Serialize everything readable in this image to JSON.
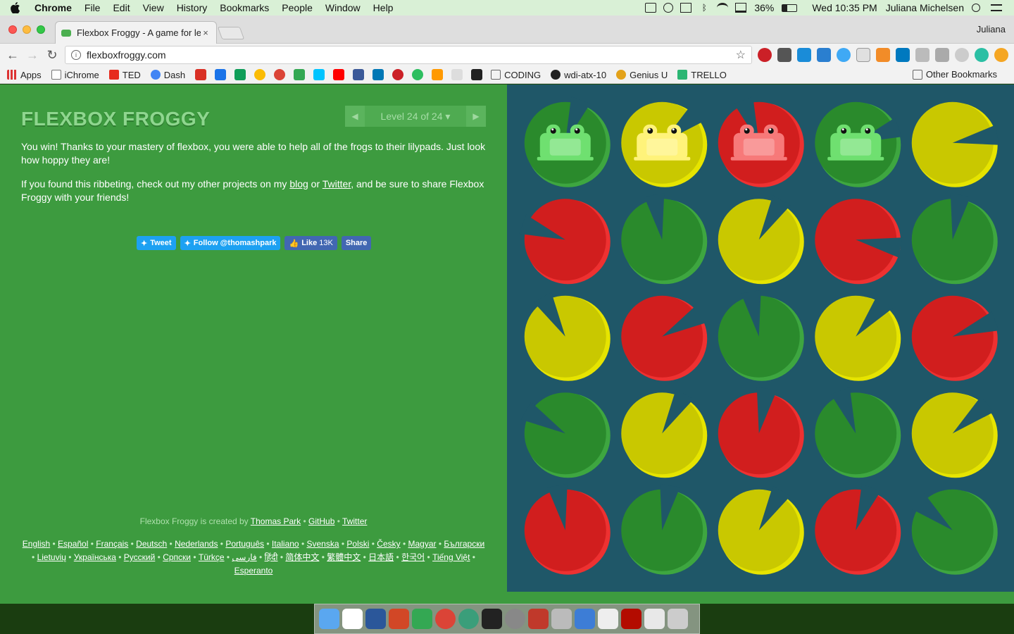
{
  "menubar": {
    "items": [
      "Chrome",
      "File",
      "Edit",
      "View",
      "History",
      "Bookmarks",
      "People",
      "Window",
      "Help"
    ],
    "battery": "36%",
    "clock": "Wed 10:35 PM",
    "user": "Juliana Michelsen"
  },
  "tab": {
    "title": "Flexbox Froggy - A game for le",
    "close": "×"
  },
  "profile": "Juliana",
  "omnibox": {
    "url": "flexboxfroggy.com"
  },
  "bookmarks": {
    "apps": "Apps",
    "ichrome": "iChrome",
    "ted": "TED",
    "dash": "Dash",
    "coding": "CODING",
    "wdi": "wdi-atx-10",
    "genius": "Genius U",
    "trello": "TRELLO",
    "other": "Other Bookmarks"
  },
  "game": {
    "logo": "FLEXBOX FROGGY",
    "level": "Level 24 of 24",
    "win_text": "You win! Thanks to your mastery of flexbox, you were able to help all of the frogs to their lilypads. Just look how hoppy they are!",
    "p2_a": "If you found this ribbeting, check out my other projects on my ",
    "p2_blog": "blog",
    "p2_or": " or ",
    "p2_twitter": "Twitter",
    "p2_b": ", and be sure to share Flexbox Froggy with your friends!",
    "tweet": "Tweet",
    "follow": "Follow @thomashpark",
    "like": "Like",
    "like_count": "13K",
    "share": "Share"
  },
  "credits": {
    "prefix": "Flexbox Froggy is created by ",
    "author": "Thomas Park",
    "github": "GitHub",
    "twitter": "Twitter"
  },
  "languages": [
    "English",
    "Español",
    "Français",
    "Deutsch",
    "Nederlands",
    "Português",
    "Italiano",
    "Svenska",
    "Polski",
    "Česky",
    "Magyar",
    "Български",
    "Lietuvių",
    "Українська",
    "Русский",
    "Српски",
    "Türkçe",
    "فارسی",
    "हिंदी",
    "简体中文",
    "繁體中文",
    "日本語",
    "한국어",
    "Tiếng Việt",
    "Esperanto"
  ],
  "pond": {
    "colors": {
      "green": "#2a8a2c",
      "green_rim": "#3ea640",
      "yellow": "#c9c800",
      "yellow_rim": "#e6e400",
      "red": "#d11e1e",
      "red_rim": "#ee3131",
      "frog_green": "#6fe070",
      "frog_yellow": "#fff37a",
      "frog_red": "#f77979",
      "water": "#1f5768"
    },
    "rows": [
      [
        "green",
        "yellow",
        "red",
        "green",
        "yellow"
      ],
      [
        "red",
        "green",
        "yellow",
        "red",
        "green"
      ],
      [
        "yellow",
        "red",
        "green",
        "yellow",
        "red"
      ],
      [
        "green",
        "yellow",
        "red",
        "green",
        "yellow"
      ],
      [
        "red",
        "green",
        "yellow",
        "red",
        "green"
      ]
    ],
    "frogs": [
      "green",
      "yellow",
      "red",
      "green"
    ]
  }
}
